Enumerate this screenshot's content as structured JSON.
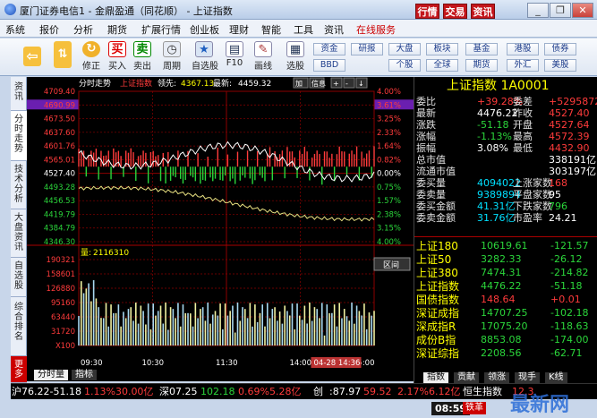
{
  "window": {
    "title": "厦门证券电信1 - 金鼎盈通（同花顺） - 上证指数",
    "top_buttons": [
      "行情",
      "交易",
      "资讯"
    ],
    "win_controls": [
      "_",
      "❐",
      "✕"
    ]
  },
  "menu": [
    "系统",
    "报价",
    "分析",
    "期货",
    "扩展行情",
    "创业板",
    "理财",
    "智能",
    "工具",
    "资讯",
    "在线服务"
  ],
  "toolbar": {
    "buttons": [
      {
        "label": "",
        "icon": "back-arrow-icon",
        "glyph": "⇦"
      },
      {
        "label": "",
        "icon": "updown-arrows-icon",
        "glyph": "⇅"
      },
      {
        "label": "修正",
        "icon": "refresh-icon",
        "glyph": "↻"
      },
      {
        "label": "买入",
        "icon": "buy-icon",
        "glyph": "买"
      },
      {
        "label": "卖出",
        "icon": "sell-icon",
        "glyph": "卖"
      },
      {
        "label": "周期",
        "icon": "clock-icon",
        "glyph": "◷"
      },
      {
        "label": "自选股",
        "icon": "star-icon",
        "glyph": "★"
      },
      {
        "label": "F10",
        "icon": "f10-icon",
        "glyph": "▤"
      },
      {
        "label": "画线",
        "icon": "pencil-icon",
        "glyph": "✎"
      },
      {
        "label": "选股",
        "icon": "picker-icon",
        "glyph": "▦"
      }
    ],
    "small_buttons": [
      "资金",
      "研报",
      "大盘",
      "板块",
      "基金",
      "港股",
      "债券",
      "BBD",
      "个股",
      "全球",
      "期货",
      "外汇",
      "美股"
    ]
  },
  "sidebar": [
    "资讯",
    "分时走势",
    "技术分析",
    "大盘资讯",
    "自选股",
    "综合排名",
    "更多"
  ],
  "chart": {
    "header": {
      "label1": "分时走势",
      "label2": "上证指数",
      "lead_label": "领先:",
      "lead_value": "4367.13",
      "latest_label": "最新:",
      "latest_value": "4459.32"
    },
    "topbtns": [
      "加",
      "信息",
      "+",
      "-",
      "↓"
    ],
    "price_ticks": [
      "4709.40",
      "4690.99",
      "4673.50",
      "4637.60",
      "4601.76",
      "4565.01",
      "4527.40",
      "4493.28",
      "4456.53",
      "4419.79",
      "4384.79",
      "4346.30"
    ],
    "pct_ticks": [
      "4.00%",
      "3.61%",
      "3.25%",
      "2.33%",
      "1.64%",
      "0.82%",
      "0.00%",
      "0.75%",
      "1.57%",
      "2.38%",
      "3.15%",
      "4.00%"
    ],
    "vol_label": "量:",
    "vol_value": "2116310",
    "vol_ticks": [
      "190321",
      "158601",
      "126880",
      "95160",
      "63440",
      "31720",
      "X100"
    ],
    "time_ticks": [
      "09:30",
      "10:30",
      "11:30",
      "14:00",
      "15:00"
    ],
    "date_badge": "04-28 14:36",
    "tabs": [
      "分时量",
      "指标"
    ],
    "interval_btn": "区间"
  },
  "quote": {
    "title": "上证指数 1A0001",
    "rows": [
      [
        "委比",
        "+39.28%",
        "委差",
        "+5295872"
      ],
      [
        "最新",
        "4476.22",
        "昨收",
        "4527.40"
      ],
      [
        "涨跌",
        "-51.18",
        "开盘",
        "4527.64"
      ],
      [
        "涨幅",
        "-1.13%",
        "最高",
        "4572.39"
      ],
      [
        "振幅",
        "3.08%",
        "最低",
        "4432.90"
      ],
      [
        "总市值",
        "",
        "",
        "338191亿"
      ],
      [
        "流通市值",
        "",
        "",
        "303197亿"
      ],
      [
        "委买量",
        "4094022",
        "上涨家数",
        "168"
      ],
      [
        "委卖量",
        "9389894",
        "平盘家数",
        "95"
      ],
      [
        "委买金额",
        "41.31亿",
        "下跌家数",
        "796"
      ],
      [
        "委卖金额",
        "31.76亿",
        "市盈率",
        "24.21"
      ]
    ],
    "indices": [
      [
        "上证180",
        "10619.61",
        "-121.57"
      ],
      [
        "上证50",
        "3282.33",
        "-26.12"
      ],
      [
        "上证380",
        "7474.31",
        "-214.82"
      ],
      [
        "上证指数",
        "4476.22",
        "-51.18"
      ],
      [
        "国债指数",
        "148.64",
        "+0.01"
      ],
      [
        "深证成指",
        "14707.25",
        "-102.18"
      ],
      [
        "深成指R",
        "17075.20",
        "-118.63"
      ],
      [
        "成份B指",
        "8853.08",
        "-174.00"
      ],
      [
        "深证综指",
        "2208.56",
        "-62.71"
      ]
    ],
    "tabs": [
      "指数",
      "贡献",
      "领涨",
      "现手",
      "K线"
    ]
  },
  "statusbar": {
    "text1": "沪76.22-51.18",
    "text2": "1.13%30.00亿",
    "text3": "深07.25",
    "text4": "102.18",
    "text5": "0.69%5.28亿",
    "text6": "创",
    "text7": ":87.97",
    "text8": "59.52",
    "text9": "2.17%6.12亿",
    "text10": "恒生指数",
    "text11": "12.3"
  },
  "clock": {
    "time": "08:59",
    "badge": "铁革"
  },
  "watermark": "最新网",
  "colors": {
    "up": "#ff3b3b",
    "down": "#2bd63b",
    "yellow": "#ffff00",
    "white": "#ffffff",
    "cyan": "#00e0ff",
    "grid": "#8b0000"
  }
}
